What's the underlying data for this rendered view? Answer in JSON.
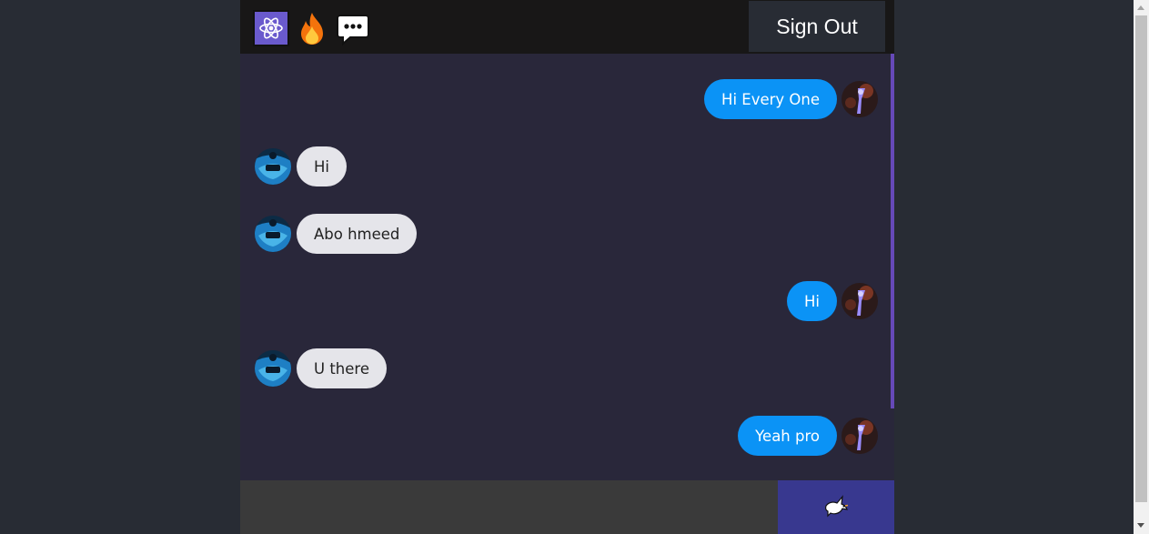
{
  "header": {
    "icons": [
      "react-atom-icon",
      "fire-icon",
      "speech-bubble-icon"
    ],
    "sign_out_label": "Sign Out"
  },
  "messages": [
    {
      "side": "sent",
      "text": "Hi Every One"
    },
    {
      "side": "received",
      "text": "Hi"
    },
    {
      "side": "received",
      "text": "Abo hmeed"
    },
    {
      "side": "sent",
      "text": "Hi"
    },
    {
      "side": "received",
      "text": "U there"
    },
    {
      "side": "sent",
      "text": "Yeah pro"
    }
  ],
  "composer": {
    "input_value": "",
    "send_icon": "dove-icon"
  },
  "colors": {
    "sent_bubble": "#0b93f6",
    "received_bubble": "#e5e5ea",
    "chat_background": "#29273a",
    "send_button": "#38388f",
    "header": "#181717"
  }
}
